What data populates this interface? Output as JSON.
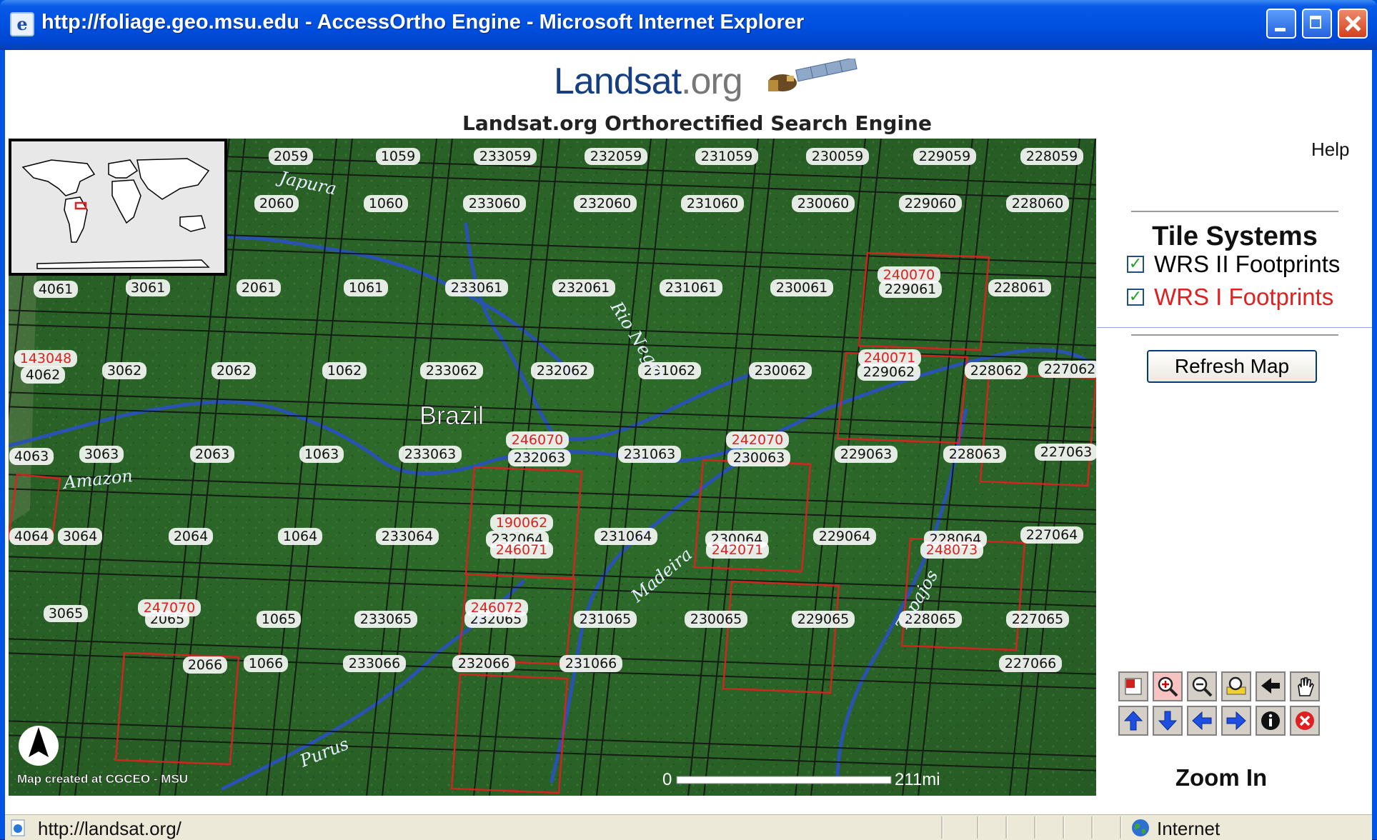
{
  "window": {
    "title": "http://foliage.geo.msu.edu - AccessOrtho Engine - Microsoft Internet Explorer"
  },
  "page": {
    "logo_main": "Landsat",
    "logo_suffix": ".org",
    "title": "Landsat.org Orthorectified Search Engine",
    "help_label": "Help"
  },
  "panel": {
    "title": "Tile Systems",
    "layers": [
      {
        "label": "WRS II Footprints",
        "checked": true,
        "color": "#111111"
      },
      {
        "label": "WRS I Footprints",
        "checked": true,
        "color": "#e02020"
      }
    ],
    "refresh_label": "Refresh Map",
    "tools": [
      {
        "icon": "full-extent-icon"
      },
      {
        "icon": "zoom-in-icon"
      },
      {
        "icon": "zoom-out-icon"
      },
      {
        "icon": "zoom-window-icon"
      },
      {
        "icon": "back-icon"
      },
      {
        "icon": "pan-hand-icon"
      },
      {
        "icon": "pan-up-icon"
      },
      {
        "icon": "pan-down-icon"
      },
      {
        "icon": "pan-left-icon"
      },
      {
        "icon": "pan-right-icon"
      },
      {
        "icon": "info-icon"
      },
      {
        "icon": "clear-icon"
      }
    ],
    "active_tool_label": "Zoom In"
  },
  "map": {
    "country_label": "Brazil",
    "credit": "Map created at CGCEO - MSU",
    "scale_start": "0",
    "scale_end": "211mi",
    "colors": {
      "wrs2": "#111111",
      "wrs1": "#e02020",
      "land": "#2d6a2a",
      "river": "#2b4fa8"
    },
    "rivers": [
      "Japura",
      "Rio Negro",
      "Amazon",
      "Madeira",
      "Tapajos",
      "Purus"
    ],
    "tiles_wrs2": [
      "2059",
      "1059",
      "233059",
      "232059",
      "231059",
      "230059",
      "229059",
      "228059",
      "2060",
      "1060",
      "233060",
      "232060",
      "231060",
      "230060",
      "229060",
      "228060",
      "4061",
      "3061",
      "2061",
      "1061",
      "233061",
      "232061",
      "231061",
      "230061",
      "229061",
      "228061",
      "4062",
      "3062",
      "2062",
      "1062",
      "233062",
      "232062",
      "231062",
      "230062",
      "229062",
      "228062",
      "227062",
      "4063",
      "3063",
      "2063",
      "1063",
      "233063",
      "232063",
      "231063",
      "230063",
      "229063",
      "228063",
      "227063",
      "4064",
      "3064",
      "2064",
      "1064",
      "233064",
      "232064",
      "231064",
      "230064",
      "229064",
      "228064",
      "227064",
      "3065",
      "2065",
      "1065",
      "233065",
      "232065",
      "231065",
      "230065",
      "229065",
      "228065",
      "227065",
      "2066",
      "1066",
      "233066",
      "232066",
      "231066",
      "227066"
    ],
    "tiles_wrs1": [
      "240070",
      "143048",
      "240071",
      "246070",
      "242070",
      "190062",
      "246071",
      "242071",
      "248073",
      "247070",
      "246072"
    ]
  },
  "status": {
    "url": "http://landsat.org/",
    "zone": "Internet"
  }
}
